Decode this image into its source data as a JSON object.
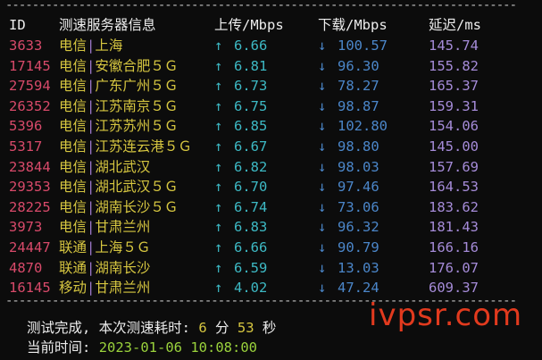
{
  "header": {
    "id": "ID",
    "node": "测速服务器信息",
    "upload": "上传/Mbps",
    "download": "下载/Mbps",
    "latency": "延迟/ms"
  },
  "rows": [
    {
      "id": "3633",
      "isp": "电信",
      "location": "上海",
      "upload": "6.66",
      "download": "100.57",
      "latency": "145.74"
    },
    {
      "id": "17145",
      "isp": "电信",
      "location": "安徽合肥５Ｇ",
      "upload": "6.81",
      "download": "96.30",
      "latency": "155.82"
    },
    {
      "id": "27594",
      "isp": "电信",
      "location": "广东广州５Ｇ",
      "upload": "6.73",
      "download": "78.27",
      "latency": "165.37"
    },
    {
      "id": "26352",
      "isp": "电信",
      "location": "江苏南京５Ｇ",
      "upload": "6.75",
      "download": "98.87",
      "latency": "159.31"
    },
    {
      "id": "5396",
      "isp": "电信",
      "location": "江苏苏州５Ｇ",
      "upload": "6.85",
      "download": "102.80",
      "latency": "154.06"
    },
    {
      "id": "5317",
      "isp": "电信",
      "location": "江苏连云港５Ｇ",
      "upload": "6.67",
      "download": "98.80",
      "latency": "145.00"
    },
    {
      "id": "23844",
      "isp": "电信",
      "location": "湖北武汉",
      "upload": "6.82",
      "download": "98.03",
      "latency": "157.69"
    },
    {
      "id": "29353",
      "isp": "电信",
      "location": "湖北武汉５Ｇ",
      "upload": "6.70",
      "download": "97.46",
      "latency": "164.53"
    },
    {
      "id": "28225",
      "isp": "电信",
      "location": "湖南长沙５Ｇ",
      "upload": "6.74",
      "download": "73.06",
      "latency": "183.62"
    },
    {
      "id": "3973",
      "isp": "电信",
      "location": "甘肃兰州",
      "upload": "6.83",
      "download": "96.32",
      "latency": "181.43"
    },
    {
      "id": "24447",
      "isp": "联通",
      "location": "上海５Ｇ",
      "upload": "6.66",
      "download": "90.79",
      "latency": "166.16"
    },
    {
      "id": "4870",
      "isp": "联通",
      "location": "湖南长沙",
      "upload": "6.59",
      "download": "13.03",
      "latency": "176.07"
    },
    {
      "id": "16145",
      "isp": "移动",
      "location": "甘肃兰州",
      "upload": "4.02",
      "download": "47.24",
      "latency": "609.37"
    }
  ],
  "symbols": {
    "separator": "|",
    "up_arrow": "↑",
    "down_arrow": "↓",
    "rule": "----------------------------------------------------------------------------------------------------------------"
  },
  "summary": {
    "done_label": "测试完成, 本次测速耗时:",
    "minutes": "6",
    "minutes_unit": "分",
    "seconds": "53",
    "seconds_unit": "秒",
    "time_label": "当前时间:",
    "timestamp": "2023-01-06 10:08:00"
  },
  "watermark": "ivpsr.com",
  "colors": {
    "background": "#0c0c0c",
    "id": "#d84a6a",
    "isp": "#d6c640",
    "upload": "#3db9c4",
    "download": "#4b86c9",
    "latency": "#a58bd8",
    "timestamp": "#9ad23c",
    "watermark": "#e23a1e"
  }
}
